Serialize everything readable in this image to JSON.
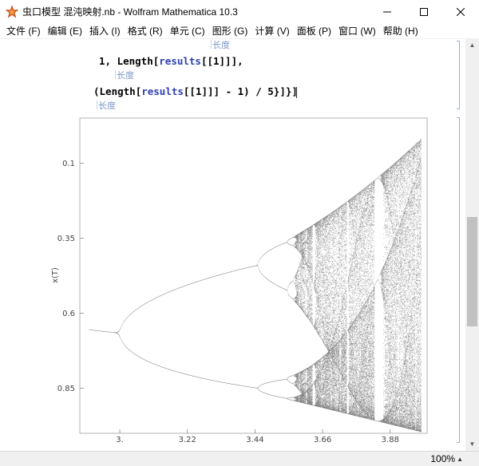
{
  "window": {
    "title": "虫口模型 混沌映射.nb - Wolfram Mathematica 10.3",
    "icons": {
      "app": "mathematica-star-icon",
      "minimize": "minimize-icon",
      "maximize": "maximize-icon",
      "close": "close-icon"
    }
  },
  "menu": {
    "items": [
      "文件 (F)",
      "编辑 (E)",
      "插入 (I)",
      "格式 (R)",
      "单元 (C)",
      "图形 (G)",
      "计算 (V)",
      "面板 (P)",
      "窗口 (W)",
      "帮助 (H)"
    ]
  },
  "notebook": {
    "hint_top": "长度",
    "code_line1_prefix": "1, ",
    "code_line1_func": "Length",
    "code_line1_open": "[",
    "code_line1_sym": "results",
    "code_line1_rest": "[[1]]],",
    "hint_middle": "长度",
    "code_line2_open": "(",
    "code_line2_func": "Length",
    "code_line2_open2": "[",
    "code_line2_sym": "results",
    "code_line2_rest": "[[1]]] - 1) / 5}]}]",
    "hint_bottom": "长度"
  },
  "chart_data": {
    "type": "scatter",
    "title": "",
    "xlabel": "",
    "ylabel": "x(T)",
    "x_ticks": [
      "3.",
      "3.22",
      "3.44",
      "3.66",
      "3.88"
    ],
    "x_tick_values": [
      3.0,
      3.22,
      3.44,
      3.66,
      3.88
    ],
    "y_ticks": [
      "0.1",
      "0.35",
      "0.6",
      "0.85"
    ],
    "y_tick_values": [
      0.1,
      0.35,
      0.6,
      0.85
    ],
    "xlim": [
      2.87,
      4.0
    ],
    "ylim": [
      1.0,
      -0.05
    ],
    "y_axis_reversed": true,
    "description_series": "logistic map bifurcation: x(n+1) = r x(n) (1 - x(n))",
    "color": "#1a1a1a",
    "frame": true,
    "grid": false
  },
  "statusbar": {
    "zoom": "100%"
  }
}
